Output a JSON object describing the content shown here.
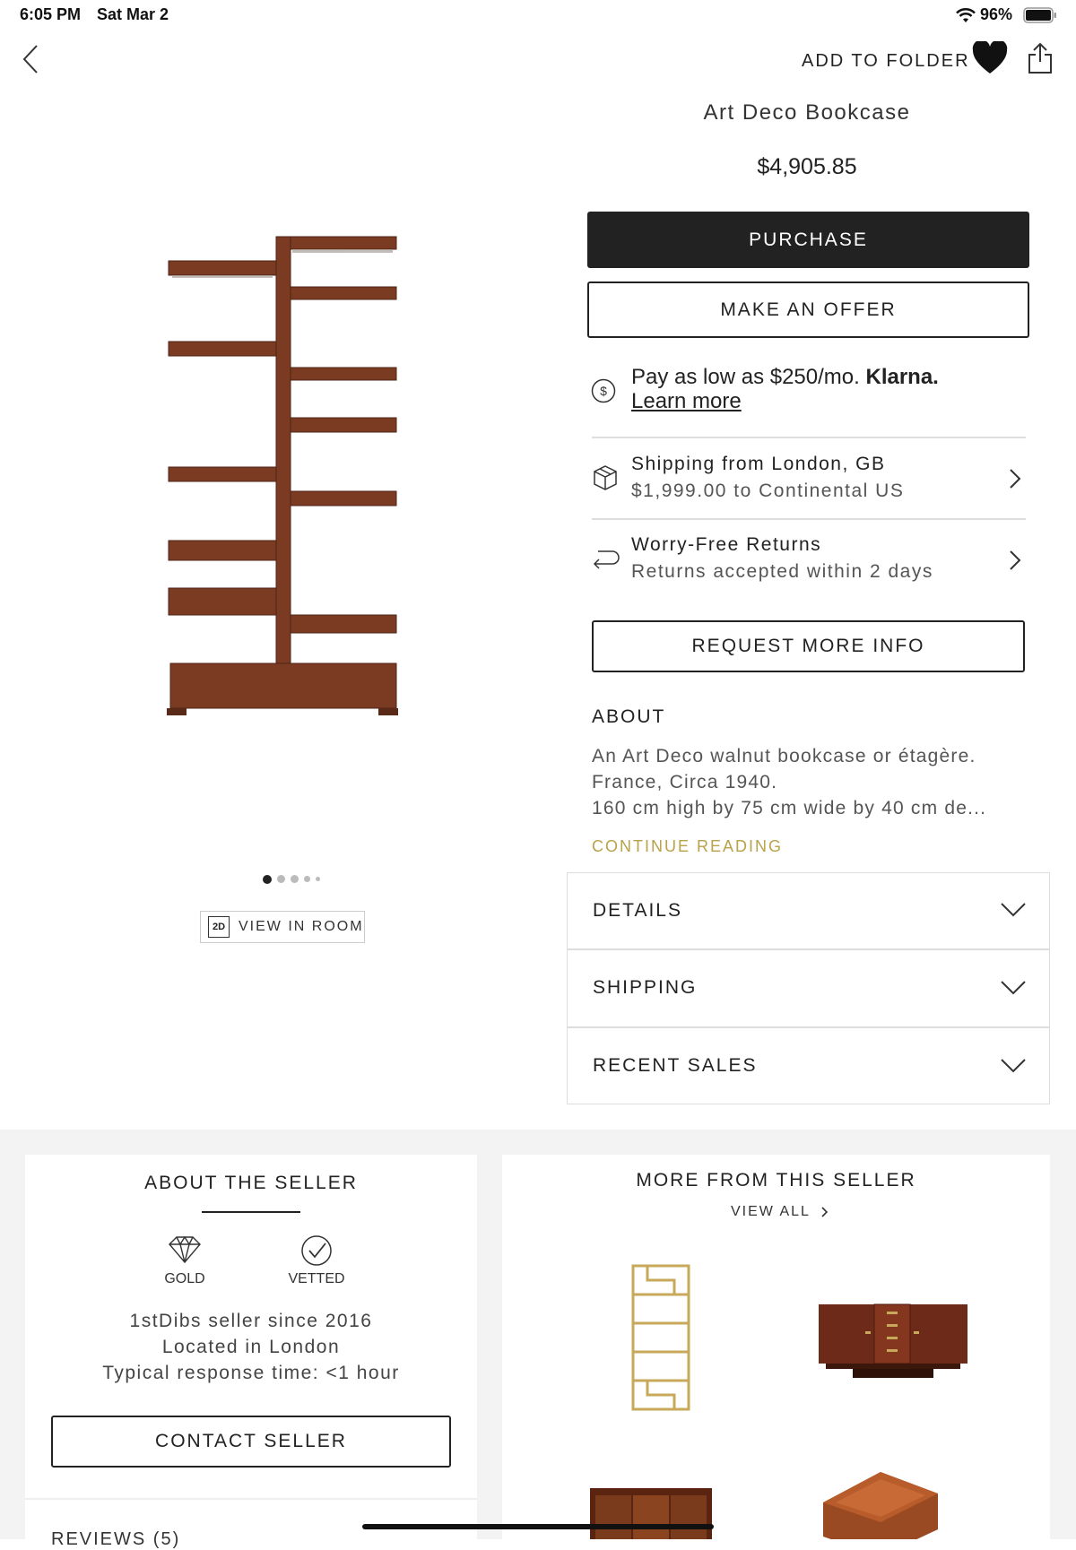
{
  "status_bar": {
    "time": "6:05 PM",
    "date": "Sat Mar 2",
    "battery": "96%"
  },
  "header": {
    "add_to_folder": "ADD TO FOLDER"
  },
  "product": {
    "title": "Art Deco Bookcase",
    "price": "$4,905.85",
    "purchase_label": "PURCHASE",
    "offer_label": "MAKE AN OFFER"
  },
  "klarna": {
    "text": "Pay as low as $250/mo.",
    "brand": "Klarna.",
    "link": "Learn more"
  },
  "shipping_row": {
    "title": "Shipping from London, GB",
    "subtitle": "$1,999.00 to Continental US"
  },
  "returns_row": {
    "title": "Worry-Free Returns",
    "subtitle": "Returns accepted within 2 days"
  },
  "request_info_label": "REQUEST MORE INFO",
  "about": {
    "heading": "ABOUT",
    "line1": "An Art Deco walnut bookcase or étagère.",
    "line2": "France, Circa 1940.",
    "line3": "160 cm high by 75 cm wide by 40 cm de...",
    "continue": "CONTINUE READING"
  },
  "gallery": {
    "view_in_room_badge": "2D",
    "view_in_room": "VIEW IN ROOM",
    "dot_count": 5,
    "active_dot": 0
  },
  "accordions": [
    {
      "label": "DETAILS"
    },
    {
      "label": "SHIPPING"
    },
    {
      "label": "RECENT SALES"
    }
  ],
  "seller": {
    "heading": "ABOUT THE SELLER",
    "badges": [
      {
        "label": "GOLD",
        "icon": "diamond-icon"
      },
      {
        "label": "VETTED",
        "icon": "check-circle-icon"
      }
    ],
    "since": "1stDibs seller since 2016",
    "location": "Located in London",
    "response": "Typical response time: <1 hour",
    "contact_label": "CONTACT SELLER",
    "reviews": "REVIEWS (5)"
  },
  "more_from_seller": {
    "heading": "MORE FROM THIS SELLER",
    "view_all": "VIEW ALL"
  },
  "colors": {
    "accent_gold": "#b9a24a",
    "wood": "#7a3b22",
    "dark": "#222222",
    "brass": "#c8a85a"
  }
}
